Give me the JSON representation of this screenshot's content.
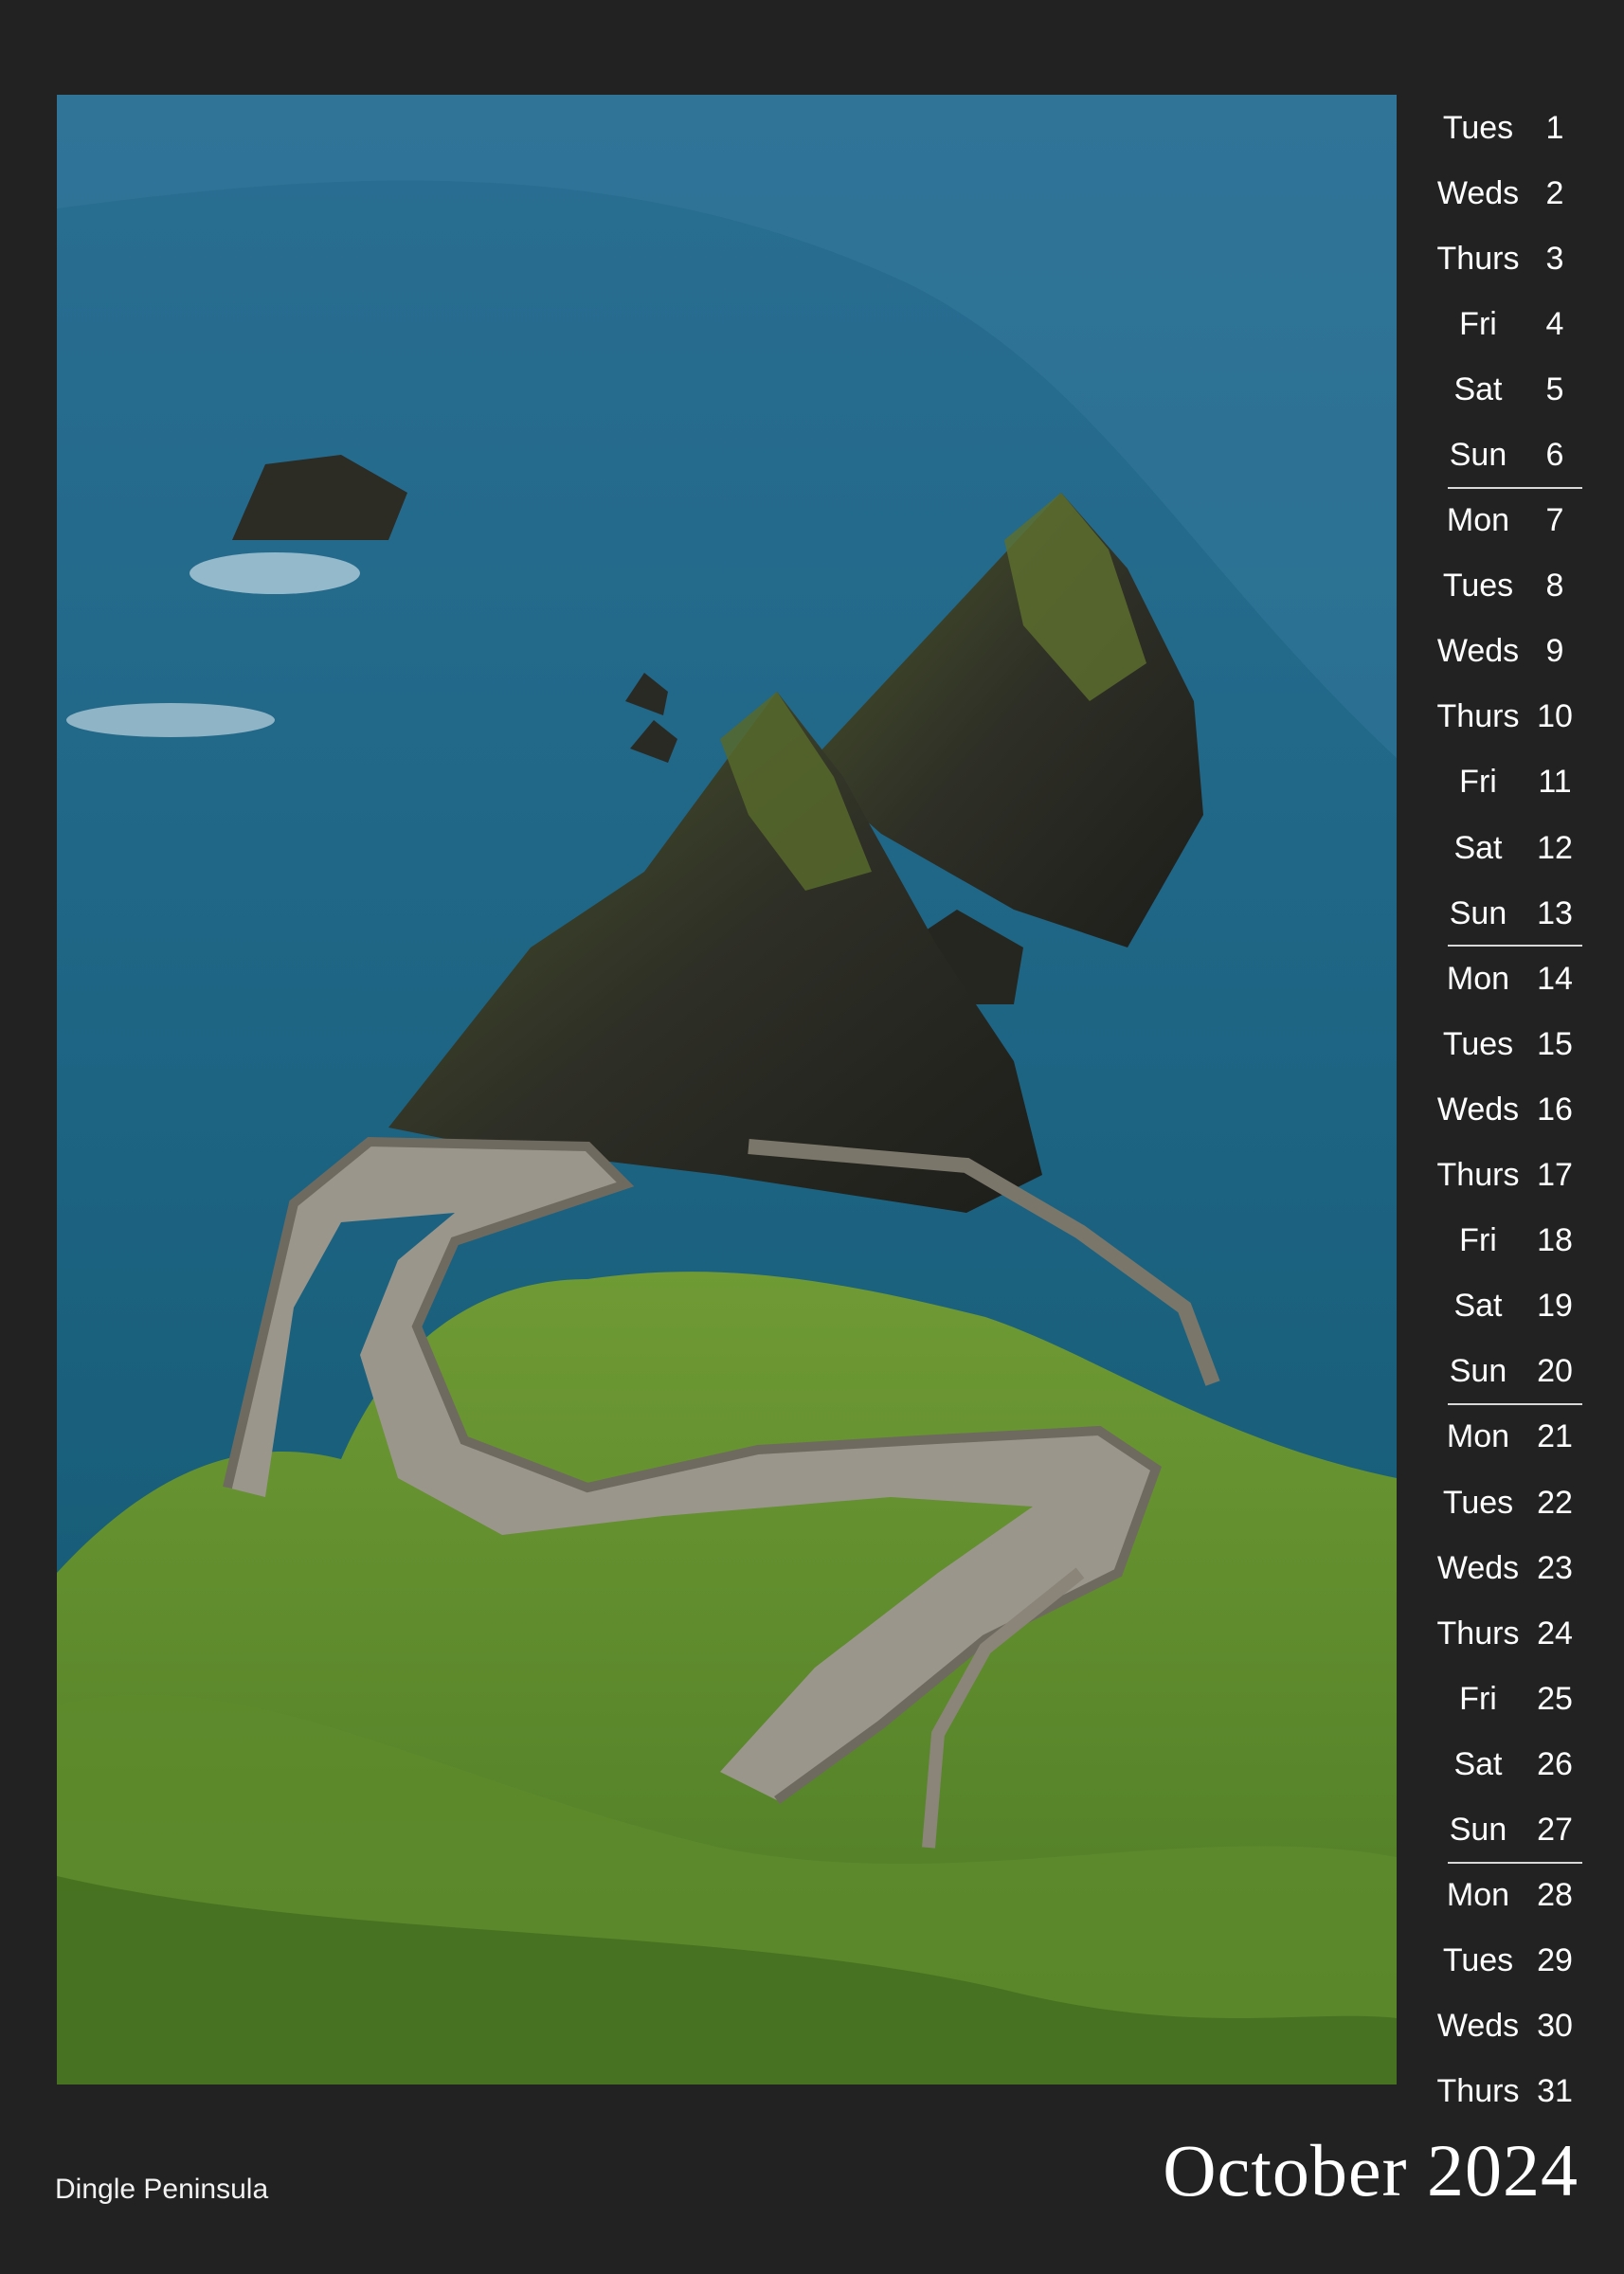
{
  "calendar": {
    "month_title": "October 2024",
    "caption": "Dingle Peninsula",
    "days": [
      {
        "name": "Tues",
        "num": "1"
      },
      {
        "name": "Weds",
        "num": "2"
      },
      {
        "name": "Thurs",
        "num": "3"
      },
      {
        "name": "Fri",
        "num": "4"
      },
      {
        "name": "Sat",
        "num": "5"
      },
      {
        "name": "Sun",
        "num": "6"
      },
      {
        "name": "Mon",
        "num": "7"
      },
      {
        "name": "Tues",
        "num": "8"
      },
      {
        "name": "Weds",
        "num": "9"
      },
      {
        "name": "Thurs",
        "num": "10"
      },
      {
        "name": "Fri",
        "num": "11"
      },
      {
        "name": "Sat",
        "num": "12"
      },
      {
        "name": "Sun",
        "num": "13"
      },
      {
        "name": "Mon",
        "num": "14"
      },
      {
        "name": "Tues",
        "num": "15"
      },
      {
        "name": "Weds",
        "num": "16"
      },
      {
        "name": "Thurs",
        "num": "17"
      },
      {
        "name": "Fri",
        "num": "18"
      },
      {
        "name": "Sat",
        "num": "19"
      },
      {
        "name": "Sun",
        "num": "20"
      },
      {
        "name": "Mon",
        "num": "21"
      },
      {
        "name": "Tues",
        "num": "22"
      },
      {
        "name": "Weds",
        "num": "23"
      },
      {
        "name": "Thurs",
        "num": "24"
      },
      {
        "name": "Fri",
        "num": "25"
      },
      {
        "name": "Sat",
        "num": "26"
      },
      {
        "name": "Sun",
        "num": "27"
      },
      {
        "name": "Mon",
        "num": "28"
      },
      {
        "name": "Tues",
        "num": "29"
      },
      {
        "name": "Weds",
        "num": "30"
      },
      {
        "name": "Thurs",
        "num": "31"
      }
    ]
  },
  "colors": {
    "background": "#222222",
    "text": "#ffffff",
    "week_separator": "#d8d8d8"
  }
}
